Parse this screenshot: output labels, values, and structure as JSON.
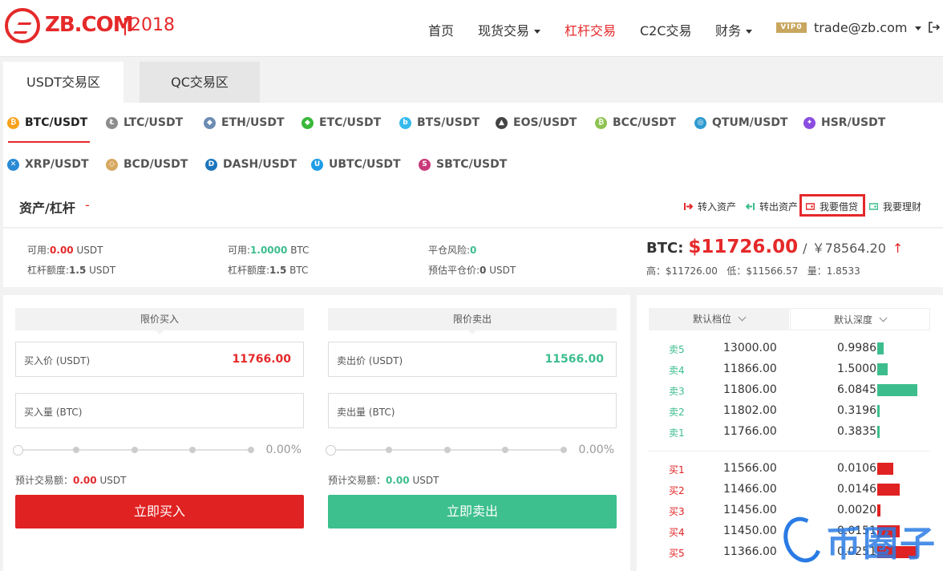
{
  "header": {
    "logo_text": "ZB.COM",
    "logo_year": "2018",
    "nav": [
      {
        "label": "首页",
        "dropdown": false,
        "active": false
      },
      {
        "label": "现货交易",
        "dropdown": true,
        "active": false
      },
      {
        "label": "杠杆交易",
        "dropdown": false,
        "active": true
      },
      {
        "label": "C2C交易",
        "dropdown": false,
        "active": false
      },
      {
        "label": "财务",
        "dropdown": true,
        "active": false
      }
    ],
    "vip_badge": "VIP0",
    "user": "trade@zb.com"
  },
  "tabs": [
    {
      "label": "USDT交易区",
      "active": true
    },
    {
      "label": "QC交易区",
      "active": false
    }
  ],
  "pairs": [
    {
      "label": "BTC/USDT",
      "icon": "bitcoin-icon",
      "color": "#f7a11a",
      "glyph": "₿",
      "active": true
    },
    {
      "label": "LTC/USDT",
      "icon": "litecoin-icon",
      "color": "#8c8c8c",
      "glyph": "Ł"
    },
    {
      "label": "ETH/USDT",
      "icon": "ethereum-icon",
      "color": "#6b8cb3",
      "glyph": "◆"
    },
    {
      "label": "ETC/USDT",
      "icon": "ethereum-classic-icon",
      "color": "#3ab83a",
      "glyph": "◆"
    },
    {
      "label": "BTS/USDT",
      "icon": "bitshares-icon",
      "color": "#35baeb",
      "glyph": "b"
    },
    {
      "label": "EOS/USDT",
      "icon": "eos-icon",
      "color": "#444444",
      "glyph": "▲"
    },
    {
      "label": "BCC/USDT",
      "icon": "bitcoin-cash-icon",
      "color": "#8dc351",
      "glyph": "₿"
    },
    {
      "label": "QTUM/USDT",
      "icon": "qtum-icon",
      "color": "#2e9ad0",
      "glyph": "◎"
    },
    {
      "label": "HSR/USDT",
      "icon": "hshare-icon",
      "color": "#8a4ce0",
      "glyph": "✦"
    },
    {
      "label": "XRP/USDT",
      "icon": "ripple-icon",
      "color": "#2a8ad4",
      "glyph": "✕"
    },
    {
      "label": "BCD/USDT",
      "icon": "bitcoin-diamond-icon",
      "color": "#d7a960",
      "glyph": "◇"
    },
    {
      "label": "DASH/USDT",
      "icon": "dash-icon",
      "color": "#1c75bc",
      "glyph": "D"
    },
    {
      "label": "UBTC/USDT",
      "icon": "united-bitcoin-icon",
      "color": "#1e9ce6",
      "glyph": "U"
    },
    {
      "label": "SBTC/USDT",
      "icon": "super-bitcoin-icon",
      "color": "#c93a7a",
      "glyph": "S"
    }
  ],
  "assets": {
    "title": "资产/杠杆",
    "dash": "-",
    "actions": [
      {
        "label": "转入资产",
        "icon": "transfer-in-icon",
        "color": "#e5292a"
      },
      {
        "label": "转出资产",
        "icon": "transfer-out-icon",
        "color": "#3dbd8d"
      },
      {
        "label": "我要借贷",
        "icon": "loan-icon",
        "color": "#e5292a"
      },
      {
        "label": "我要理财",
        "icon": "finance-icon",
        "color": "#3dbd8d"
      }
    ]
  },
  "stats": {
    "usdt_available_label": "可用:",
    "usdt_available": "0.00",
    "usdt_unit": "USDT",
    "usdt_leverage_label": "杠杆额度:",
    "usdt_leverage": "1.5",
    "btc_available_label": "可用:",
    "btc_available": "1.0000",
    "btc_unit": "BTC",
    "btc_leverage_label": "杠杆额度:",
    "btc_leverage": "1.5",
    "risk_label": "平仓风险:",
    "risk": "0",
    "liq_label": "预估平仓价:",
    "liq": "0",
    "liq_unit": "USDT"
  },
  "ticker": {
    "label": "BTC:",
    "price": "$11726.00",
    "sep": "/",
    "cny": "￥78564.20",
    "arrow": "↑",
    "high": "高：$11726.00",
    "low": "低：$11566.57",
    "volume": "量：1.8533"
  },
  "buy": {
    "header": "限价买入",
    "price_label": "买入价 (USDT)",
    "price": "11766.00",
    "amount_placeholder": "买入量 (BTC)",
    "percent": "0.00%",
    "est_label": "预计交易额：",
    "est_value": "0.00",
    "est_unit": "USDT",
    "button": "立即买入",
    "color": "#e02222"
  },
  "sell": {
    "header": "限价卖出",
    "price_label": "卖出价 (USDT)",
    "price": "11566.00",
    "amount_placeholder": "卖出量 (BTC)",
    "percent": "0.00%",
    "est_label": "预计交易额：",
    "est_value": "0.00",
    "est_unit": "USDT",
    "button": "立即卖出",
    "color": "#3dbf8e"
  },
  "orderbook": {
    "tick_selector": "默认档位",
    "depth_selector": "默认深度",
    "asks": [
      {
        "label": "卖5",
        "price": "13000.00",
        "amount": "0.9986",
        "fill": 0.16
      },
      {
        "label": "卖4",
        "price": "11866.00",
        "amount": "1.5000",
        "fill": 0.25
      },
      {
        "label": "卖3",
        "price": "11806.00",
        "amount": "6.0845",
        "fill": 1.0
      },
      {
        "label": "卖2",
        "price": "11802.00",
        "amount": "0.3196",
        "fill": 0.05
      },
      {
        "label": "卖1",
        "price": "11766.00",
        "amount": "0.3835",
        "fill": 0.06
      }
    ],
    "bids": [
      {
        "label": "买1",
        "price": "11566.00",
        "amount": "0.0106",
        "fill": 0.4
      },
      {
        "label": "买2",
        "price": "11466.00",
        "amount": "0.0146",
        "fill": 0.55
      },
      {
        "label": "买3",
        "price": "11456.00",
        "amount": "0.0020",
        "fill": 0.08
      },
      {
        "label": "买4",
        "price": "11450.00",
        "amount": "0.0151",
        "fill": 0.57
      },
      {
        "label": "买5",
        "price": "11366.00",
        "amount": "0.0251",
        "fill": 1.0
      }
    ],
    "ask_color": "#3dbd8d",
    "bid_color": "#e02222"
  },
  "watermark": "币圈子"
}
